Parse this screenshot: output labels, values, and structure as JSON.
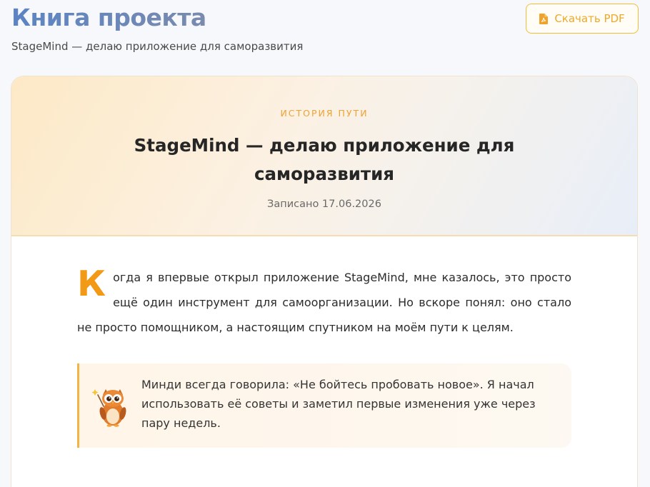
{
  "header": {
    "title": "Книга проекта",
    "subtitle": "StageMind — делаю приложение для саморазвития",
    "pdf_button": "Скачать PDF",
    "pdf_icon": "file-pdf-icon"
  },
  "article": {
    "eyebrow": "ИСТОРИЯ ПУТИ",
    "title": "StageMind — делаю приложение для саморазвития",
    "date": "Записано 17.06.2026",
    "drop_cap": "К",
    "lead": "огда я впервые открыл приложение StageMind, мне казалось, это просто ещё один инструмент для самоорганизации. Но вскоре понял: оно стало не просто помощником, а настоящим спутником на моём пути к целям.",
    "quote": {
      "icon": "owl-mascot-icon",
      "text": "Минди всегда говорила: «Не бойтесь пробовать новое». Я начал использовать её советы и заметил первые изменения уже через пару недель."
    }
  },
  "colors": {
    "accent": "#f29a16",
    "button_border": "#f3bd3a",
    "title_gradient_start": "#5b84c4",
    "title_gradient_end": "#b8975d"
  }
}
